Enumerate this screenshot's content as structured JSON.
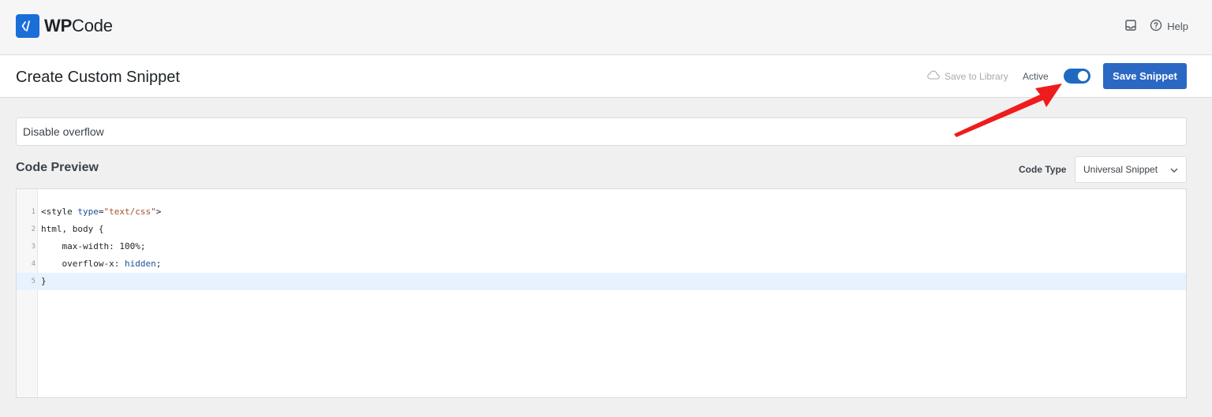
{
  "brand": {
    "name_bold": "WP",
    "name_rest": "Code"
  },
  "topbar": {
    "help_label": "Help"
  },
  "header": {
    "title": "Create Custom Snippet",
    "save_to_library": "Save to Library",
    "active_label": "Active",
    "active": true,
    "save_button": "Save Snippet"
  },
  "snippet": {
    "title_value": "Disable overflow"
  },
  "code_preview": {
    "section_title": "Code Preview",
    "code_type_label": "Code Type",
    "code_type_value": "Universal Snippet",
    "lines": [
      {
        "num": "1",
        "parts": [
          [
            "<style ",
            "plain"
          ],
          [
            "type",
            "attr"
          ],
          [
            "=",
            "plain"
          ],
          [
            "\"text/css\"",
            "str"
          ],
          [
            ">",
            "plain"
          ]
        ]
      },
      {
        "num": "2",
        "parts": [
          [
            "html, body {",
            "plain"
          ]
        ]
      },
      {
        "num": "3",
        "parts": [
          [
            "    max-width: 100%;",
            "plain"
          ]
        ]
      },
      {
        "num": "4",
        "parts": [
          [
            "    overflow-x: ",
            "plain"
          ],
          [
            "hidden",
            "val"
          ],
          [
            ";",
            "plain"
          ]
        ]
      },
      {
        "num": "5",
        "parts": [
          [
            "}",
            "plain"
          ]
        ]
      }
    ],
    "active_line": 5
  },
  "colors": {
    "accent": "#2b68c4",
    "annotation_arrow": "#ee1c1c"
  }
}
